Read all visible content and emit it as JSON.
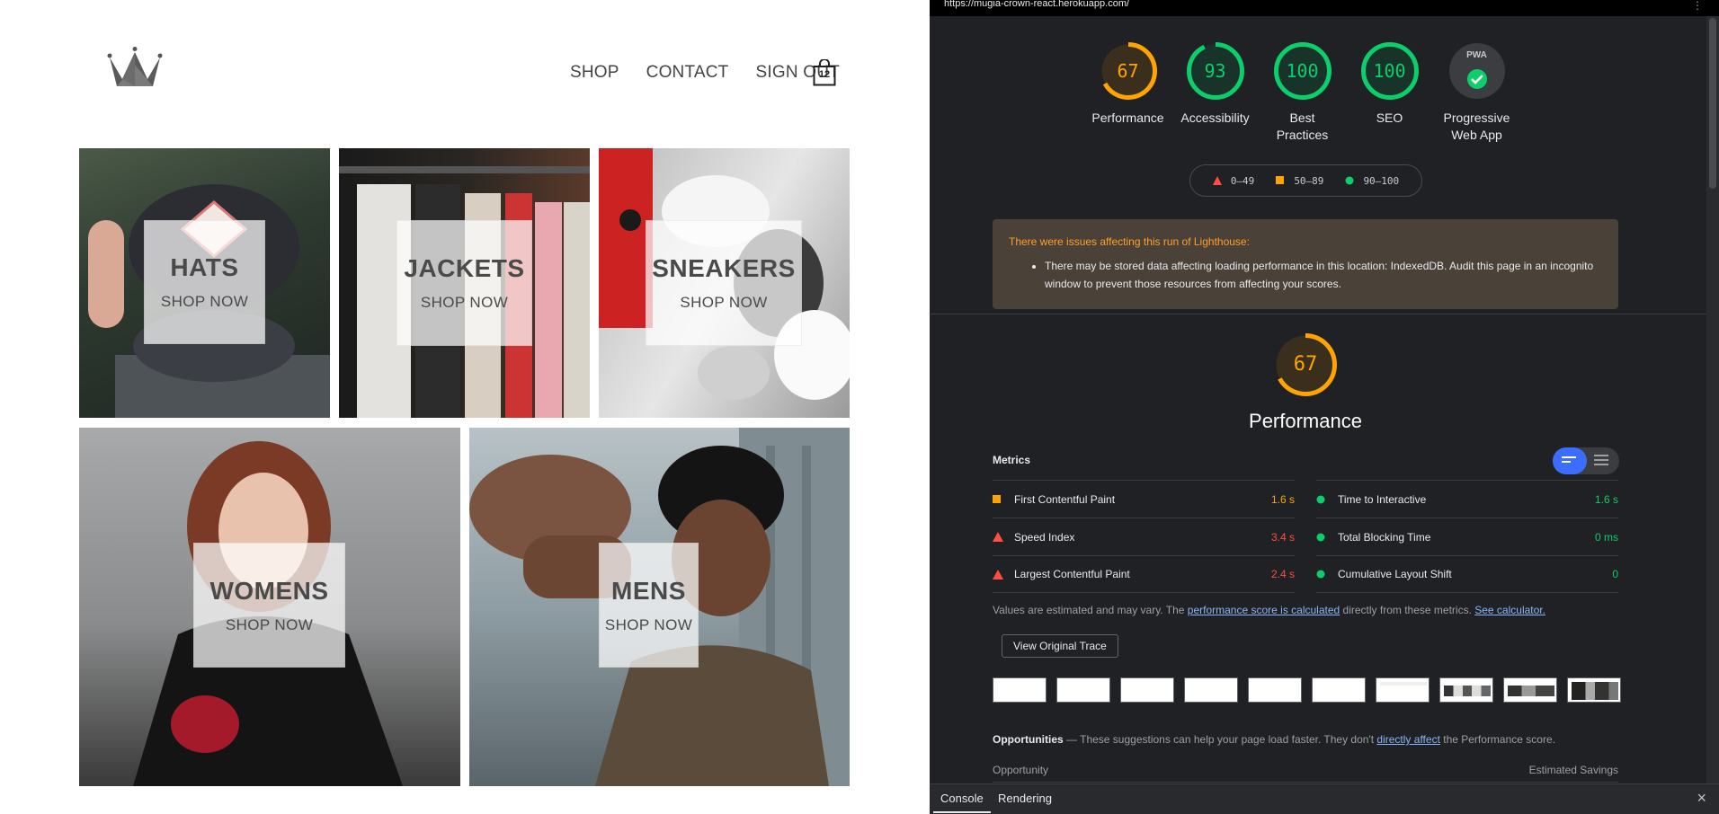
{
  "site": {
    "nav": [
      "SHOP",
      "CONTACT",
      "SIGN OUT"
    ],
    "cart_count": "12",
    "categories": [
      {
        "title": "HATS",
        "subtitle": "SHOP NOW"
      },
      {
        "title": "JACKETS",
        "subtitle": "SHOP NOW"
      },
      {
        "title": "SNEAKERS",
        "subtitle": "SHOP NOW"
      },
      {
        "title": "WOMENS",
        "subtitle": "SHOP NOW"
      },
      {
        "title": "MENS",
        "subtitle": "SHOP NOW"
      }
    ]
  },
  "devtools": {
    "url": "https://mugia-crown-react.herokuapp.com/",
    "gauges": [
      {
        "score": "67",
        "label": "Performance",
        "color": "#ffa400",
        "fraction": 0.67
      },
      {
        "score": "93",
        "label": "Accessibility",
        "color": "#0cce6b",
        "fraction": 0.93
      },
      {
        "score": "100",
        "label": "Best Practices",
        "color": "#0cce6b",
        "fraction": 1.0
      },
      {
        "score": "100",
        "label": "SEO",
        "color": "#0cce6b",
        "fraction": 1.0
      },
      {
        "score": "PWA",
        "label": "Progressive Web App",
        "color": "#0cce6b"
      }
    ],
    "legend": [
      "0–49",
      "50–89",
      "90–100"
    ],
    "warning_title": "There were issues affecting this run of Lighthouse:",
    "warning_item": "There may be stored data affecting loading performance in this location: IndexedDB. Audit this page in an incognito window to prevent those resources from affecting your scores.",
    "performance_score": "67",
    "performance_title": "Performance",
    "metrics_heading": "Metrics",
    "metrics_left": [
      {
        "name": "First Contentful Paint",
        "value": "1.6 s",
        "status": "average"
      },
      {
        "name": "Speed Index",
        "value": "3.4 s",
        "status": "fail"
      },
      {
        "name": "Largest Contentful Paint",
        "value": "2.4 s",
        "status": "fail"
      }
    ],
    "metrics_right": [
      {
        "name": "Time to Interactive",
        "value": "1.6 s",
        "status": "pass"
      },
      {
        "name": "Total Blocking Time",
        "value": "0 ms",
        "status": "pass"
      },
      {
        "name": "Cumulative Layout Shift",
        "value": "0",
        "status": "pass"
      }
    ],
    "note_pre": "Values are estimated and may vary. The ",
    "note_link1": "performance score is calculated",
    "note_mid": " directly from these metrics. ",
    "note_link2": "See calculator.",
    "view_trace": "View Original Trace",
    "opp_title": "Opportunities",
    "opp_pre": " — These suggestions can help your page load faster. They don't ",
    "opp_link": "directly affect",
    "opp_post": " the Performance score.",
    "opp_col1": "Opportunity",
    "opp_col2": "Estimated Savings",
    "drawer_tabs": [
      "Console",
      "Rendering"
    ],
    "colors": {
      "pass": "#0cce6b",
      "average": "#ffa400",
      "fail": "#ff4e42"
    }
  }
}
